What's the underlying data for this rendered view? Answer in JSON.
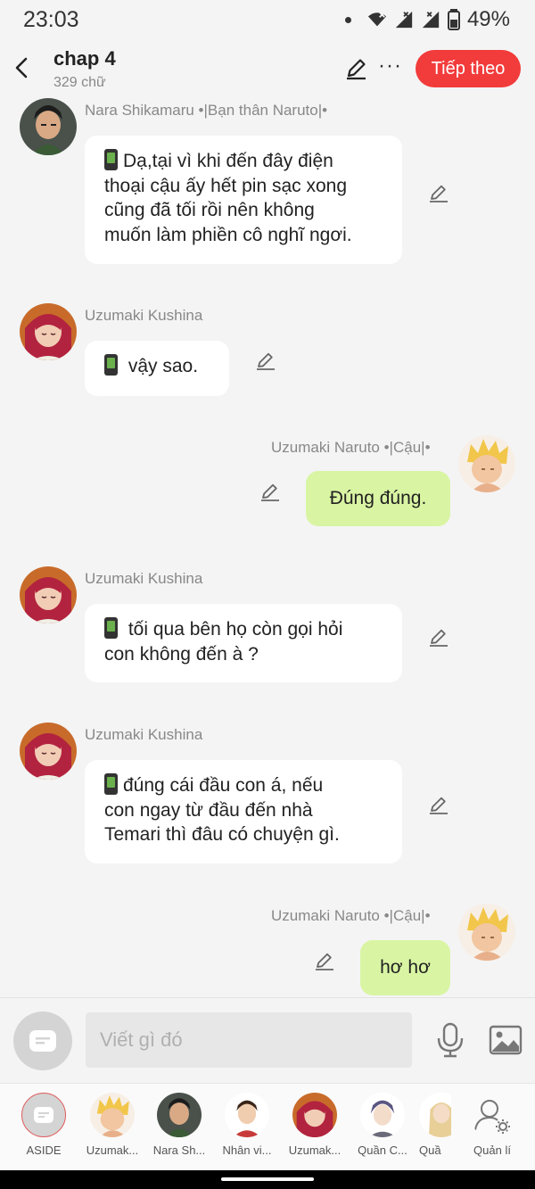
{
  "status": {
    "time": "23:03",
    "battery": "49%"
  },
  "header": {
    "title": "chap 4",
    "word_count": "329 chữ",
    "next_label": "Tiếp theo"
  },
  "messages": [
    {
      "sender": "Nara Shikamaru •|Bạn thân Naruto|•",
      "side": "left",
      "avatar": "shikamaru",
      "lines": [
        "Dạ,tại vì khi đến đây điện",
        "thoại cậu ấy hết pin sạc xong",
        "cũng đã tối rồi nên không",
        "muốn làm phiền cô nghĩ ngơi."
      ],
      "phone_emoji": true
    },
    {
      "sender": "Uzumaki Kushina",
      "side": "left",
      "avatar": "kushina",
      "lines": [
        "vậy sao."
      ],
      "phone_emoji": true
    },
    {
      "sender": "Uzumaki Naruto •|Cậu|•",
      "side": "right",
      "avatar": "naruto",
      "lines": [
        "Đúng đúng."
      ]
    },
    {
      "sender": "Uzumaki Kushina",
      "side": "left",
      "avatar": "kushina",
      "lines": [
        "tối qua bên họ còn gọi hỏi",
        "con không đến à ?"
      ],
      "phone_emoji": true
    },
    {
      "sender": "Uzumaki Kushina",
      "side": "left",
      "avatar": "kushina",
      "lines": [
        "đúng cái đầu con á, nếu",
        "con ngay từ đầu đến nhà",
        "Temari thì đâu có chuyện gì."
      ],
      "phone_emoji": true
    },
    {
      "sender": "Uzumaki Naruto •|Cậu|•",
      "side": "right",
      "avatar": "naruto",
      "lines": [
        "hơ hơ"
      ]
    }
  ],
  "input": {
    "placeholder": "Viết gì đó"
  },
  "characters": [
    {
      "label": "ASIDE",
      "icon": "aside-icon"
    },
    {
      "label": "Uzumak...",
      "avatar": "naruto"
    },
    {
      "label": "Nara Sh...",
      "avatar": "shikamaru"
    },
    {
      "label": "Nhân vi...",
      "avatar": "boy"
    },
    {
      "label": "Uzumak...",
      "avatar": "kushina"
    },
    {
      "label": "Quần C...",
      "avatar": "purple"
    },
    {
      "label": "Quầ",
      "avatar": "blonde"
    },
    {
      "label": "Quản lí",
      "icon": "user-settings-icon"
    }
  ],
  "colors": {
    "accent": "#f23b3b",
    "bubble_right": "#d9f5a3",
    "bubble_left": "#ffffff",
    "background": "#f4f4f4"
  }
}
